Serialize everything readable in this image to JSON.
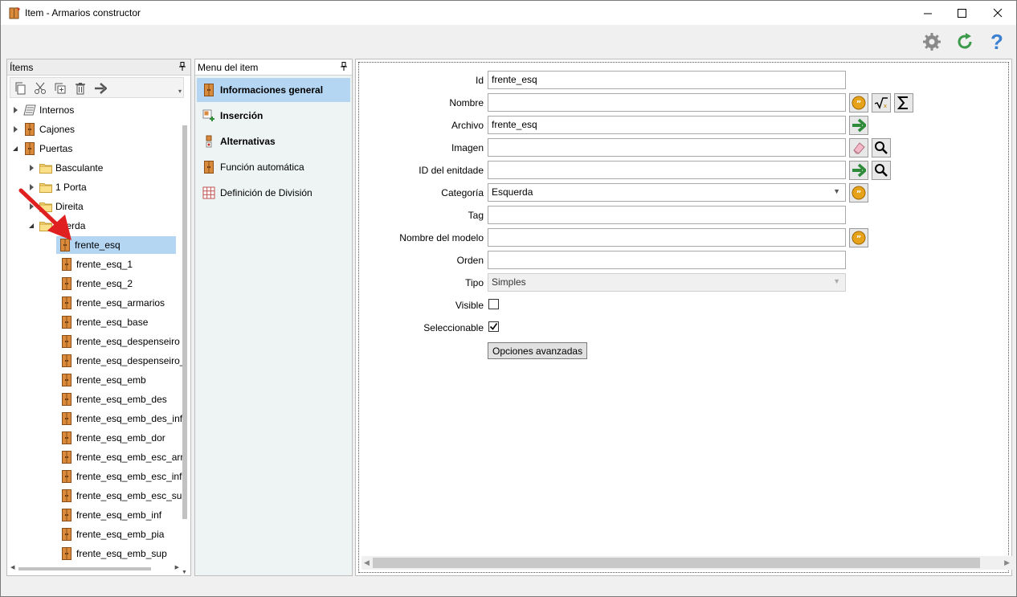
{
  "window": {
    "title": "Item - Armarios constructor",
    "controls": {
      "minimize": "—",
      "maximize": "☐",
      "close": "✕"
    }
  },
  "top_toolbar": {
    "icons": [
      "gear-icon",
      "refresh-icon",
      "help-icon"
    ],
    "help_glyph": "?"
  },
  "items_panel": {
    "title": "Ítems",
    "pin": "ꟷ",
    "toolbar": [
      "copy-icon",
      "cut-icon",
      "duplicate-icon",
      "delete-icon",
      "move-icon"
    ],
    "tree": [
      {
        "label": "Internos",
        "level": 0,
        "expander": "closed",
        "icon": "internos-icon"
      },
      {
        "label": "Cajones",
        "level": 0,
        "expander": "closed",
        "icon": "door-icon"
      },
      {
        "label": "Puertas",
        "level": 0,
        "expander": "open",
        "icon": "door-icon"
      },
      {
        "label": "Basculante",
        "level": 1,
        "expander": "closed",
        "icon": "folder-icon"
      },
      {
        "label": "1 Porta",
        "level": 1,
        "expander": "closed",
        "icon": "folder-icon"
      },
      {
        "label": "Direita",
        "level": 1,
        "expander": "closed",
        "icon": "folder-icon"
      },
      {
        "label": "querda",
        "level": 1,
        "expander": "open",
        "icon": "folder-icon"
      },
      {
        "label": "frente_esq",
        "level": 2,
        "expander": "none",
        "icon": "door-icon",
        "selected": true
      },
      {
        "label": "frente_esq_1",
        "level": 2,
        "expander": "none",
        "icon": "door-icon"
      },
      {
        "label": "frente_esq_2",
        "level": 2,
        "expander": "none",
        "icon": "door-icon"
      },
      {
        "label": "frente_esq_armarios",
        "level": 2,
        "expander": "none",
        "icon": "door-icon"
      },
      {
        "label": "frente_esq_base",
        "level": 2,
        "expander": "none",
        "icon": "door-icon"
      },
      {
        "label": "frente_esq_despenseiro",
        "level": 2,
        "expander": "none",
        "icon": "door-icon"
      },
      {
        "label": "frente_esq_despenseiro_",
        "level": 2,
        "expander": "none",
        "icon": "door-icon"
      },
      {
        "label": "frente_esq_emb",
        "level": 2,
        "expander": "none",
        "icon": "door-icon"
      },
      {
        "label": "frente_esq_emb_des",
        "level": 2,
        "expander": "none",
        "icon": "door-icon"
      },
      {
        "label": "frente_esq_emb_des_inf",
        "level": 2,
        "expander": "none",
        "icon": "door-icon"
      },
      {
        "label": "frente_esq_emb_dor",
        "level": 2,
        "expander": "none",
        "icon": "door-icon"
      },
      {
        "label": "frente_esq_emb_esc_arr",
        "level": 2,
        "expander": "none",
        "icon": "door-icon"
      },
      {
        "label": "frente_esq_emb_esc_inf",
        "level": 2,
        "expander": "none",
        "icon": "door-icon"
      },
      {
        "label": "frente_esq_emb_esc_sup",
        "level": 2,
        "expander": "none",
        "icon": "door-icon"
      },
      {
        "label": "frente_esq_emb_inf",
        "level": 2,
        "expander": "none",
        "icon": "door-icon"
      },
      {
        "label": "frente_esq_emb_pia",
        "level": 2,
        "expander": "none",
        "icon": "door-icon"
      },
      {
        "label": "frente_esq_emb_sup",
        "level": 2,
        "expander": "none",
        "icon": "door-icon"
      }
    ]
  },
  "menu_panel": {
    "title": "Menu del item",
    "pin": "ꟷ",
    "items": [
      {
        "label": "Informaciones general",
        "icon": "door-icon",
        "active": true,
        "bold": true
      },
      {
        "label": "Inserción",
        "icon": "insert-icon",
        "active": false,
        "bold": true
      },
      {
        "label": "Alternativas",
        "icon": "alternatives-icon",
        "active": false,
        "bold": true
      },
      {
        "label": "Función automática",
        "icon": "door-icon",
        "active": false,
        "bold": false
      },
      {
        "label": "Definición de División",
        "icon": "grid-icon",
        "active": false,
        "bold": false
      }
    ]
  },
  "form": {
    "id": {
      "label": "Id",
      "value": "frente_esq"
    },
    "nombre": {
      "label": "Nombre",
      "value": ""
    },
    "archivo": {
      "label": "Archivo",
      "value": "frente_esq"
    },
    "imagen": {
      "label": "Imagen",
      "value": ""
    },
    "id_entidad": {
      "label": "ID del enitdade",
      "value": ""
    },
    "categoria": {
      "label": "Categoría",
      "value": "Esquerda"
    },
    "tag": {
      "label": "Tag",
      "value": ""
    },
    "nombre_modelo": {
      "label": "Nombre del modelo",
      "value": ""
    },
    "orden": {
      "label": "Orden",
      "value": ""
    },
    "tipo": {
      "label": "Tipo",
      "value": "Simples"
    },
    "visible": {
      "label": "Visible",
      "checked": false
    },
    "seleccionable": {
      "label": "Seleccionable",
      "checked": true
    },
    "advanced_button": "Opciones avanzadas"
  },
  "colors": {
    "selection": "#b4d6f3",
    "door_orange": "#d98a3a",
    "arrow_green": "#2e8b3a",
    "arrow_red": "#e02020"
  }
}
